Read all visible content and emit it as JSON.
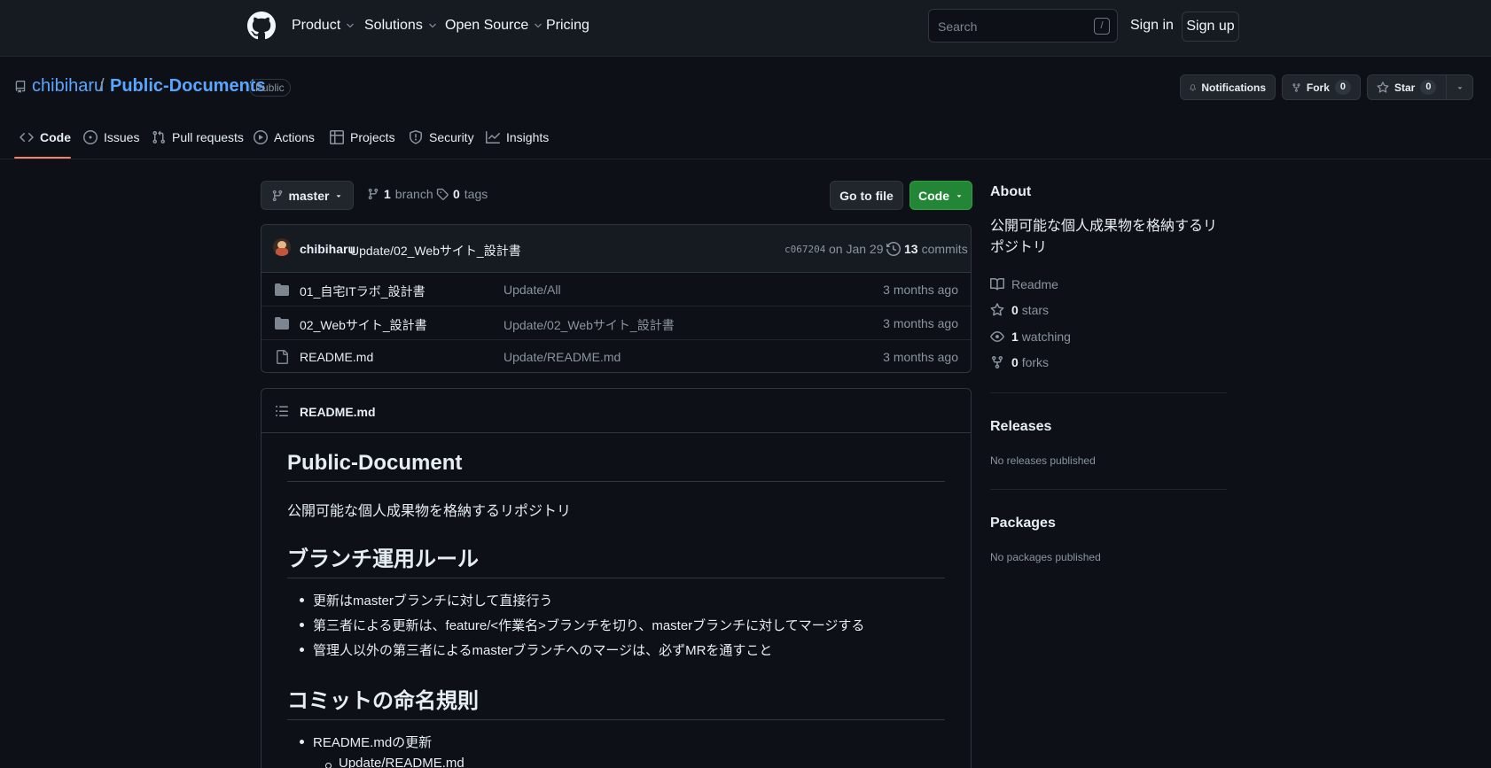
{
  "header": {
    "nav": [
      "Product",
      "Solutions",
      "Open Source",
      "Pricing"
    ],
    "search_placeholder": "Search",
    "search_shortcut": "/",
    "sign_in": "Sign in",
    "sign_up": "Sign up"
  },
  "repo": {
    "owner": "chibiharu",
    "separator": "/",
    "name": "Public-Documents",
    "visibility": "Public",
    "notifications_label": "Notifications",
    "fork_label": "Fork",
    "fork_count": "0",
    "star_label": "Star",
    "star_count": "0"
  },
  "tabs": [
    "Code",
    "Issues",
    "Pull requests",
    "Actions",
    "Projects",
    "Security",
    "Insights"
  ],
  "branch_bar": {
    "branch": "master",
    "branches_count": "1",
    "branches_label": "branch",
    "tags_count": "0",
    "tags_label": "tags",
    "go_to_file": "Go to file",
    "code_button": "Code"
  },
  "commit": {
    "author": "chibiharu",
    "message": "Update/02_Webサイト_設計書",
    "hash": "c067204",
    "date": "on Jan 29",
    "commits_count": "13",
    "commits_label": "commits"
  },
  "files": [
    {
      "name": "01_自宅ITラボ_設計書",
      "message": "Update/All",
      "age": "3 months ago",
      "type": "folder"
    },
    {
      "name": "02_Webサイト_設計書",
      "message": "Update/02_Webサイト_設計書",
      "age": "3 months ago",
      "type": "folder"
    },
    {
      "name": "README.md",
      "message": "Update/README.md",
      "age": "3 months ago",
      "type": "file"
    }
  ],
  "readme": {
    "filename": "README.md",
    "h1": "Public-Document",
    "intro": "公開可能な個人成果物を格納するリポジトリ",
    "h2_branch": "ブランチ運用ルール",
    "branch_rules": [
      "更新はmasterブランチに対して直接行う",
      "第三者による更新は、feature/<作業名>ブランチを切り、masterブランチに対してマージする",
      "管理人以外の第三者によるmasterブランチへのマージは、必ずMRを通すこと"
    ],
    "h2_commit": "コミットの命名規則",
    "commit_rules": [
      "README.mdの更新"
    ],
    "commit_sub_rules": [
      "Update/README.md"
    ]
  },
  "about": {
    "heading": "About",
    "description": "公開可能な個人成果物を格納するリポジトリ",
    "readme_link": "Readme",
    "stars_count": "0",
    "stars_label": "stars",
    "watching_count": "1",
    "watching_label": "watching",
    "forks_count": "0",
    "forks_label": "forks",
    "releases_heading": "Releases",
    "releases_text": "No releases published",
    "packages_heading": "Packages",
    "packages_text": "No packages published"
  },
  "colors": {
    "background": "#0d1117",
    "header_bg": "#161b22",
    "link": "#58a6ff",
    "accent_tab": "#f78166",
    "code_button": "#238636"
  }
}
